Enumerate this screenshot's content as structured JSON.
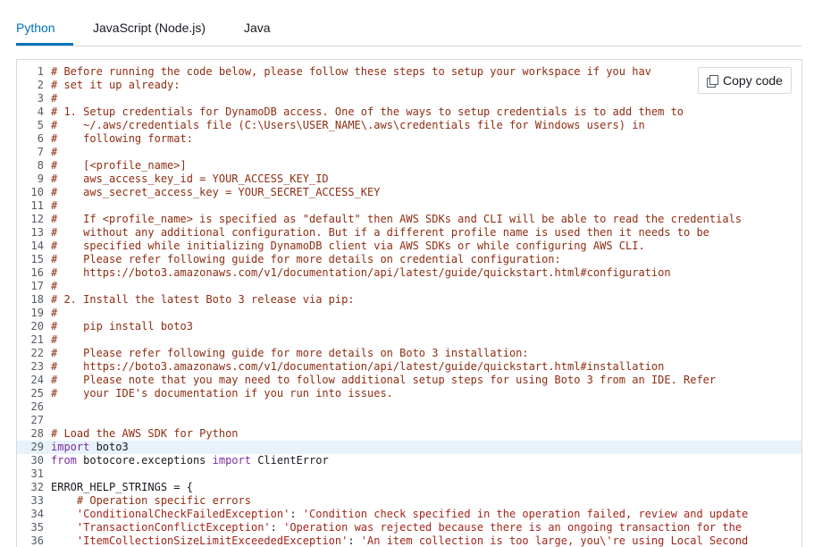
{
  "tabs": [
    {
      "label": "Python",
      "active": true
    },
    {
      "label": "JavaScript (Node.js)",
      "active": false
    },
    {
      "label": "Java",
      "active": false
    }
  ],
  "copy_button": {
    "label": "Copy code",
    "icon": "copy-icon"
  },
  "highlighted_line": 29,
  "colors": {
    "accent": "#0073bb",
    "comment": "#8e2d12",
    "keyword": "#7b2d9e",
    "string": "#a1261a"
  },
  "code_lines": [
    {
      "n": 1,
      "tokens": [
        {
          "t": "c",
          "v": "# Before running the code below, please follow these steps to setup your workspace if you hav"
        }
      ]
    },
    {
      "n": 2,
      "tokens": [
        {
          "t": "c",
          "v": "# set it up already:"
        }
      ]
    },
    {
      "n": 3,
      "tokens": [
        {
          "t": "c",
          "v": "#"
        }
      ]
    },
    {
      "n": 4,
      "tokens": [
        {
          "t": "c",
          "v": "# 1. Setup credentials for DynamoDB access. One of the ways to setup credentials is to add them to"
        }
      ]
    },
    {
      "n": 5,
      "tokens": [
        {
          "t": "c",
          "v": "#    ~/.aws/credentials file (C:\\Users\\USER_NAME\\.aws\\credentials file for Windows users) in"
        }
      ]
    },
    {
      "n": 6,
      "tokens": [
        {
          "t": "c",
          "v": "#    following format:"
        }
      ]
    },
    {
      "n": 7,
      "tokens": [
        {
          "t": "c",
          "v": "#"
        }
      ]
    },
    {
      "n": 8,
      "tokens": [
        {
          "t": "c",
          "v": "#    [<profile_name>]"
        }
      ]
    },
    {
      "n": 9,
      "tokens": [
        {
          "t": "c",
          "v": "#    aws_access_key_id = YOUR_ACCESS_KEY_ID"
        }
      ]
    },
    {
      "n": 10,
      "tokens": [
        {
          "t": "c",
          "v": "#    aws_secret_access_key = YOUR_SECRET_ACCESS_KEY"
        }
      ]
    },
    {
      "n": 11,
      "tokens": [
        {
          "t": "c",
          "v": "#"
        }
      ]
    },
    {
      "n": 12,
      "tokens": [
        {
          "t": "c",
          "v": "#    If <profile_name> is specified as \"default\" then AWS SDKs and CLI will be able to read the credentials"
        }
      ]
    },
    {
      "n": 13,
      "tokens": [
        {
          "t": "c",
          "v": "#    without any additional configuration. But if a different profile name is used then it needs to be"
        }
      ]
    },
    {
      "n": 14,
      "tokens": [
        {
          "t": "c",
          "v": "#    specified while initializing DynamoDB client via AWS SDKs or while configuring AWS CLI."
        }
      ]
    },
    {
      "n": 15,
      "tokens": [
        {
          "t": "c",
          "v": "#    Please refer following guide for more details on credential configuration:"
        }
      ]
    },
    {
      "n": 16,
      "tokens": [
        {
          "t": "c",
          "v": "#    https://boto3.amazonaws.com/v1/documentation/api/latest/guide/quickstart.html#configuration"
        }
      ]
    },
    {
      "n": 17,
      "tokens": [
        {
          "t": "c",
          "v": "#"
        }
      ]
    },
    {
      "n": 18,
      "tokens": [
        {
          "t": "c",
          "v": "# 2. Install the latest Boto 3 release via pip:"
        }
      ]
    },
    {
      "n": 19,
      "tokens": [
        {
          "t": "c",
          "v": "#"
        }
      ]
    },
    {
      "n": 20,
      "tokens": [
        {
          "t": "c",
          "v": "#    pip install boto3"
        }
      ]
    },
    {
      "n": 21,
      "tokens": [
        {
          "t": "c",
          "v": "#"
        }
      ]
    },
    {
      "n": 22,
      "tokens": [
        {
          "t": "c",
          "v": "#    Please refer following guide for more details on Boto 3 installation:"
        }
      ]
    },
    {
      "n": 23,
      "tokens": [
        {
          "t": "c",
          "v": "#    https://boto3.amazonaws.com/v1/documentation/api/latest/guide/quickstart.html#installation"
        }
      ]
    },
    {
      "n": 24,
      "tokens": [
        {
          "t": "c",
          "v": "#    Please note that you may need to follow additional setup steps for using Boto 3 from an IDE. Refer"
        }
      ]
    },
    {
      "n": 25,
      "tokens": [
        {
          "t": "c",
          "v": "#    your IDE's documentation if you run into issues."
        }
      ]
    },
    {
      "n": 26,
      "tokens": []
    },
    {
      "n": 27,
      "tokens": []
    },
    {
      "n": 28,
      "tokens": [
        {
          "t": "c",
          "v": "# Load the AWS SDK for Python"
        }
      ]
    },
    {
      "n": 29,
      "tokens": [
        {
          "t": "k",
          "v": "import"
        },
        {
          "t": "p",
          "v": " boto3"
        }
      ]
    },
    {
      "n": 30,
      "tokens": [
        {
          "t": "k",
          "v": "from"
        },
        {
          "t": "p",
          "v": " botocore.exceptions "
        },
        {
          "t": "k",
          "v": "import"
        },
        {
          "t": "p",
          "v": " ClientError"
        }
      ]
    },
    {
      "n": 31,
      "tokens": []
    },
    {
      "n": 32,
      "tokens": [
        {
          "t": "p",
          "v": "ERROR_HELP_STRINGS = {"
        }
      ]
    },
    {
      "n": 33,
      "tokens": [
        {
          "t": "p",
          "v": "    "
        },
        {
          "t": "c",
          "v": "# Operation specific errors"
        }
      ]
    },
    {
      "n": 34,
      "tokens": [
        {
          "t": "p",
          "v": "    "
        },
        {
          "t": "s",
          "v": "'ConditionalCheckFailedException'"
        },
        {
          "t": "p",
          "v": ": "
        },
        {
          "t": "s",
          "v": "'Condition check specified in the operation failed, review and update"
        }
      ]
    },
    {
      "n": 35,
      "tokens": [
        {
          "t": "p",
          "v": "    "
        },
        {
          "t": "s",
          "v": "'TransactionConflictException'"
        },
        {
          "t": "p",
          "v": ": "
        },
        {
          "t": "s",
          "v": "'Operation was rejected because there is an ongoing transaction for the"
        }
      ]
    },
    {
      "n": 36,
      "tokens": [
        {
          "t": "p",
          "v": "    "
        },
        {
          "t": "s",
          "v": "'ItemCollectionSizeLimitExceededException'"
        },
        {
          "t": "p",
          "v": ": "
        },
        {
          "t": "s",
          "v": "'An item collection is too large, you\\'re using Local Second"
        }
      ]
    }
  ]
}
